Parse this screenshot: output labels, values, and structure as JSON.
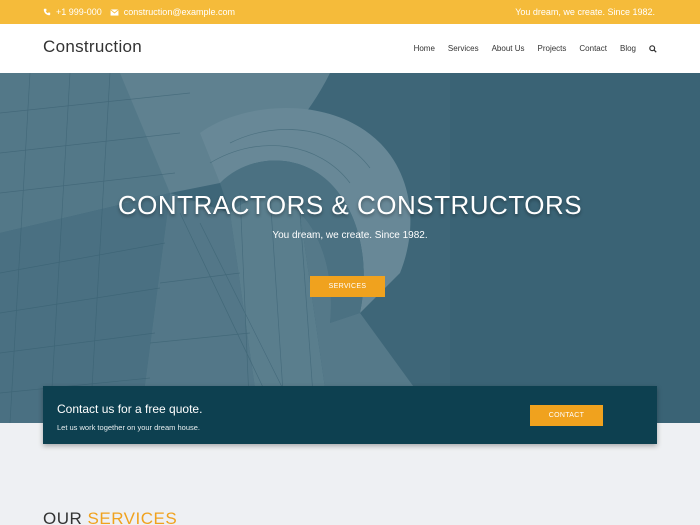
{
  "topbar": {
    "phone": "+1 999-000",
    "email": "construction@example.com",
    "tagline": "You dream, we create. Since 1982."
  },
  "header": {
    "brand": "Construction",
    "nav": [
      "Home",
      "Services",
      "About Us",
      "Projects",
      "Contact",
      "Blog"
    ]
  },
  "hero": {
    "title": "CONTRACTORS & CONSTRUCTORS",
    "subtitle": "You dream, we create. Since 1982.",
    "button_label": "SERVICES"
  },
  "quote": {
    "title": "Contact us for a free quote.",
    "subtitle": "Let us work together on your dream house.",
    "button_label": "CONTACT"
  },
  "services": {
    "heading_part1": "OUR",
    "heading_part2": "SERVICES"
  },
  "colors": {
    "topbar": "#f5bb3a",
    "accent": "#f0a21e",
    "quote_bg": "#0d4050",
    "hero_tint": "#4d7585"
  }
}
